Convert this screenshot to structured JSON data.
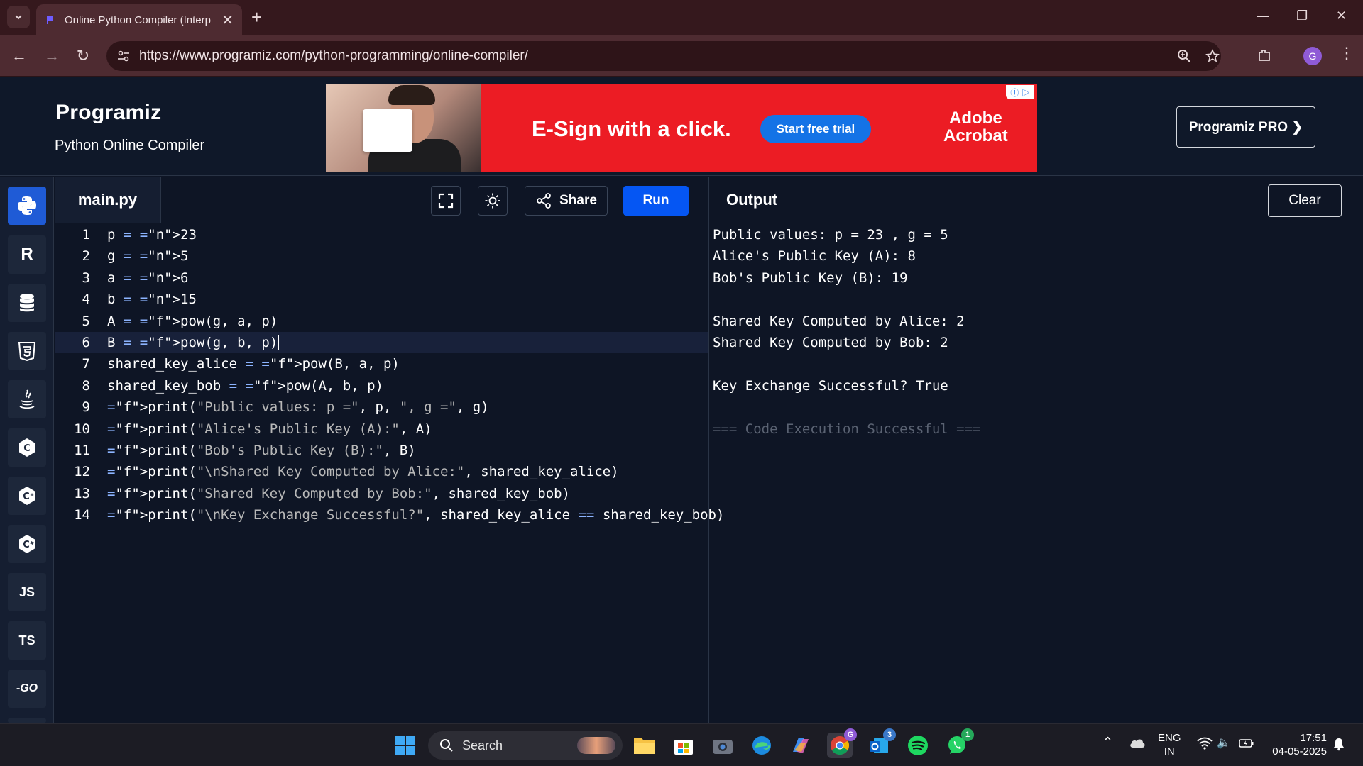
{
  "browser": {
    "tab_title": "Online Python Compiler (Interp",
    "url": "https://www.programiz.com/python-programming/online-compiler/",
    "profile_initial": "G"
  },
  "header": {
    "logo": "Programiz",
    "subtitle": "Python Online Compiler",
    "pro_button": "Programiz PRO ❯"
  },
  "ad": {
    "headline": "E-Sign with a click.",
    "cta": "Start free trial",
    "brand_line1": "Adobe",
    "brand_line2": "Acrobat"
  },
  "languages": [
    {
      "name": "python",
      "label": "",
      "active": true
    },
    {
      "name": "r",
      "label": "R"
    },
    {
      "name": "sql",
      "label": ""
    },
    {
      "name": "html",
      "label": "5"
    },
    {
      "name": "java",
      "label": ""
    },
    {
      "name": "c",
      "label": "C"
    },
    {
      "name": "cpp",
      "label": "C"
    },
    {
      "name": "csharp",
      "label": "C"
    },
    {
      "name": "javascript",
      "label": "JS"
    },
    {
      "name": "typescript",
      "label": "TS"
    },
    {
      "name": "go",
      "label": "-GO"
    }
  ],
  "editor": {
    "file_name": "main.py",
    "share_label": "Share",
    "run_label": "Run",
    "line_numbers": [
      "1",
      "2",
      "3",
      "4",
      "5",
      "6",
      "7",
      "8",
      "9",
      "10",
      "11",
      "12",
      "13",
      "14"
    ],
    "code_lines": [
      "p = 23",
      "g = 5",
      "a = 6",
      "b = 15",
      "A = pow(g, a, p)",
      "B = pow(g, b, p)",
      "shared_key_alice = pow(B, a, p)",
      "shared_key_bob = pow(A, b, p)",
      "print(\"Public values: p =\", p, \", g =\", g)",
      "print(\"Alice's Public Key (A):\", A)",
      "print(\"Bob's Public Key (B):\", B)",
      "print(\"\\nShared Key Computed by Alice:\", shared_key_alice)",
      "print(\"Shared Key Computed by Bob:\", shared_key_bob)",
      "print(\"\\nKey Exchange Successful?\", shared_key_alice == shared_key_bob)"
    ]
  },
  "output": {
    "title": "Output",
    "clear_label": "Clear",
    "lines": [
      "Public values: p = 23 , g = 5",
      "Alice's Public Key (A): 8",
      "Bob's Public Key (B): 19",
      "",
      "Shared Key Computed by Alice: 2",
      "Shared Key Computed by Bob: 2",
      "",
      "Key Exchange Successful? True",
      "",
      "=== Code Execution Successful ==="
    ]
  },
  "taskbar": {
    "search_label": "Search",
    "lang_line1": "ENG",
    "lang_line2": "IN",
    "time": "17:51",
    "date": "04-05-2025",
    "badges": {
      "chrome": "G",
      "outlook": "3",
      "whatsapp": "1"
    }
  },
  "colors": {
    "run_blue": "#0556f3",
    "ad_red": "#ec1c24",
    "editor_bg": "#0e1525",
    "number_orange": "#f08d49",
    "func_yellow": "#f9d84a"
  }
}
